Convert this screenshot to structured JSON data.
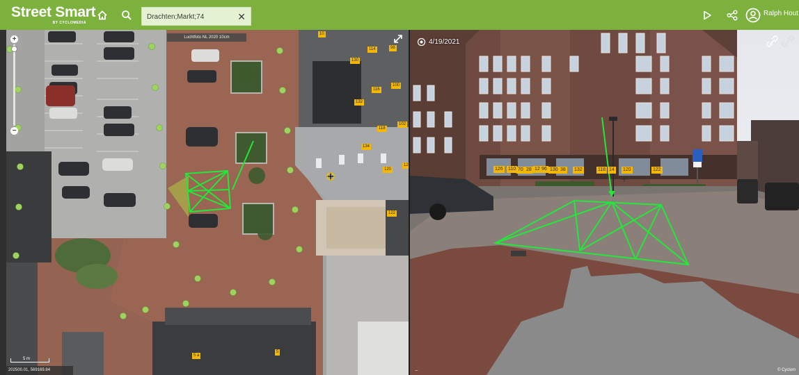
{
  "app": {
    "brand": "Street Smart",
    "brand_sub": "BY CYCLOMEDIA",
    "search_value": "Drachten;Markt;74",
    "search_clear": "✕",
    "user_name": "Ralph Hout",
    "icons": [
      "home-icon",
      "search-icon",
      "play-icon",
      "share-icon",
      "user-icon"
    ],
    "accent": "#7bb13c"
  },
  "map": {
    "title": "Luchtfoto NL 2020 10cm",
    "zoom_in": "+",
    "zoom_out": "−",
    "scale_label": "5 m",
    "coords": "202500.01, 569169.84",
    "tags": [
      "10",
      "114",
      "98",
      "130",
      "116",
      "100",
      "132",
      "118",
      "102",
      "134",
      "120",
      "12",
      "122",
      "5 a",
      "5"
    ],
    "feature_color": "#22e83a"
  },
  "pano": {
    "date": "4/19/2021",
    "copyright": "© Cyclom",
    "minus": "−",
    "tags": [
      "126",
      "110",
      "70",
      "28",
      "12",
      "96",
      "130",
      "38",
      "132",
      "118",
      "14",
      "120",
      "122"
    ]
  }
}
